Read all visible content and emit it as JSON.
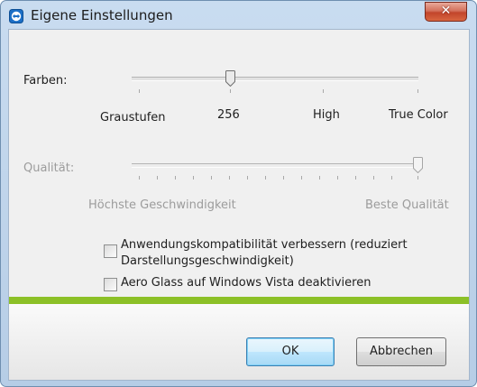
{
  "window": {
    "title": "Eigene Einstellungen",
    "close_glyph": "✕",
    "app_icon": "teamviewer-icon"
  },
  "colors_setting": {
    "label": "Farben:",
    "ticks": [
      "Graustufen",
      "256",
      "High",
      "True Color"
    ],
    "selected": "256",
    "enabled": true
  },
  "quality_setting": {
    "label": "Qualität:",
    "min_label": "Höchste Geschwindigkeit",
    "max_label": "Beste Qualität",
    "value": "max",
    "enabled": false
  },
  "options": [
    {
      "label_line1": "Anwendungskompatibilität verbessern (reduziert",
      "label_line2": "Darstellungsgeschwindigkeit)",
      "checked": false
    },
    {
      "label": "Aero Glass auf Windows Vista deaktivieren",
      "checked": false
    }
  ],
  "buttons": {
    "ok": "OK",
    "cancel": "Abbrechen"
  },
  "colors": {
    "accent_bar": "#8cc027",
    "default_button": "#bee6fd"
  }
}
